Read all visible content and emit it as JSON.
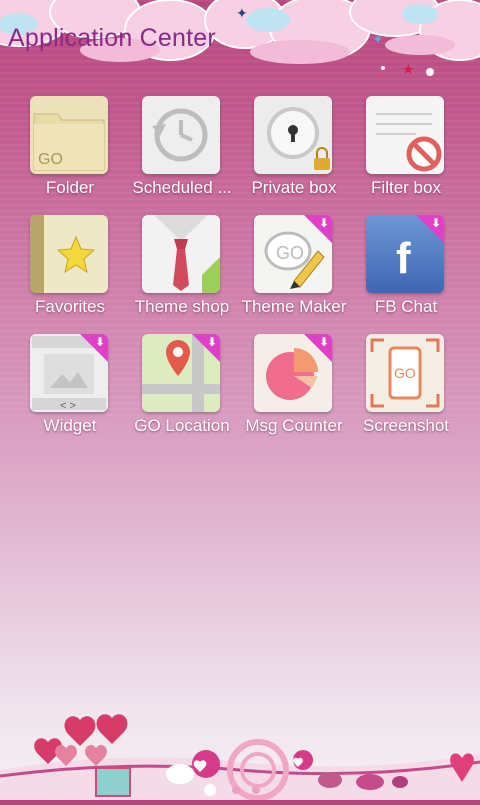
{
  "header": {
    "title": "Application Center"
  },
  "apps": [
    {
      "label": "Folder",
      "icon": "folder-icon"
    },
    {
      "label": "Scheduled ...",
      "icon": "clock-icon"
    },
    {
      "label": "Private box",
      "icon": "lock-icon"
    },
    {
      "label": "Filter box",
      "icon": "block-icon"
    },
    {
      "label": "Favorites",
      "icon": "star-icon"
    },
    {
      "label": "Theme shop",
      "icon": "tie-icon"
    },
    {
      "label": "Theme Maker",
      "icon": "pencil-icon"
    },
    {
      "label": "FB Chat",
      "icon": "facebook-icon"
    },
    {
      "label": "Widget",
      "icon": "widget-icon"
    },
    {
      "label": "GO Location",
      "icon": "map-pin-icon"
    },
    {
      "label": "Msg Counter",
      "icon": "pie-chart-icon"
    },
    {
      "label": "Screenshot",
      "icon": "screenshot-icon"
    }
  ],
  "icon_text": {
    "go": "GO",
    "fb": "f"
  },
  "page_indicator": {
    "count": 3,
    "active": 1
  },
  "colors": {
    "accent": "#8a2a86",
    "badge": "#e040c8",
    "background_top": "#b8447e"
  }
}
